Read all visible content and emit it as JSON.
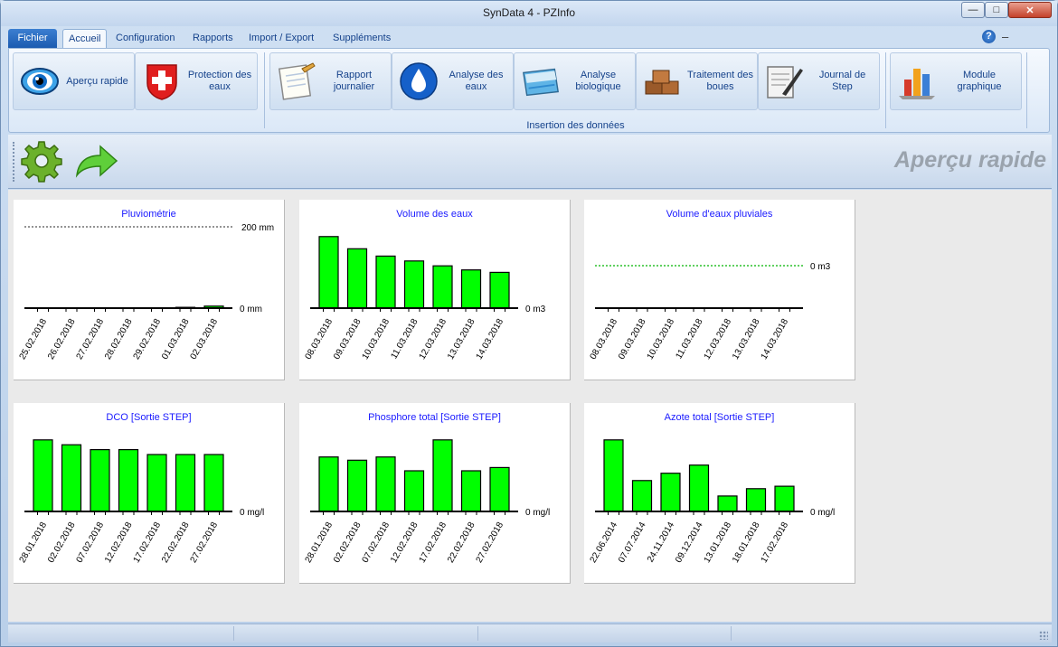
{
  "window": {
    "title": "SynData 4 - PZInfo"
  },
  "tabs": [
    {
      "label": "Fichier"
    },
    {
      "label": "Accueil"
    },
    {
      "label": "Configuration"
    },
    {
      "label": "Rapports"
    },
    {
      "label": "Import / Export"
    },
    {
      "label": "Suppléments"
    }
  ],
  "ribbon": {
    "buttons": [
      {
        "label": "Aperçu rapide",
        "icon": "eye-icon"
      },
      {
        "label": "Protection des eaux",
        "icon": "swiss-cross-icon"
      },
      {
        "label": "Rapport journalier",
        "icon": "notepad-icon"
      },
      {
        "label": "Analyse des eaux",
        "icon": "water-drop-icon"
      },
      {
        "label": "Analyse biologique",
        "icon": "basin-icon"
      },
      {
        "label": "Traitement des boues",
        "icon": "sludge-blocks-icon"
      },
      {
        "label": "Journal de Step",
        "icon": "journal-pen-icon"
      },
      {
        "label": "Module graphique",
        "icon": "bar-chart-icon"
      }
    ],
    "group_label": "Insertion des données"
  },
  "toolbar": {
    "page_title": "Aperçu rapide"
  },
  "chart_data": [
    {
      "type": "bar",
      "title": "Pluviométrie",
      "categories": [
        "25.02.2018",
        "26.02.2018",
        "27.02.2018",
        "28.02.2018",
        "29.02.2018",
        "01.03.2018",
        "02.03.2018"
      ],
      "values": [
        0,
        0,
        0,
        0,
        0,
        2,
        5
      ],
      "reference_lines": [
        {
          "value": 200,
          "label": "200 mm"
        }
      ],
      "axis_label": "0 mm",
      "ylim": [
        0,
        200
      ]
    },
    {
      "type": "bar",
      "title": "Volume des eaux",
      "categories": [
        "08.03.2018",
        "09.03.2018",
        "10.03.2018",
        "11.03.2018",
        "12.03.2018",
        "13.03.2018",
        "14.03.2018"
      ],
      "values": [
        88,
        73,
        64,
        58,
        52,
        47,
        44
      ],
      "axis_label": "0 m3",
      "ylim": [
        0,
        100
      ]
    },
    {
      "type": "bar",
      "title": "Volume d'eaux pluviales",
      "categories": [
        "08.03.2018",
        "09.03.2018",
        "10.03.2018",
        "11.03.2018",
        "12.03.2018",
        "13.03.2018",
        "14.03.2018"
      ],
      "values": [
        0,
        0,
        0,
        0,
        0,
        0,
        0
      ],
      "reference_lines": [
        {
          "value": 0,
          "label": "0 m3"
        }
      ],
      "ylim": [
        0,
        1
      ]
    },
    {
      "type": "bar",
      "title": "DCO [Sortie STEP]",
      "categories": [
        "28.01.2018",
        "02.02.2018",
        "07.02.2018",
        "12.02.2018",
        "17.02.2018",
        "22.02.2018",
        "27.02.2018"
      ],
      "values": [
        88,
        82,
        76,
        76,
        70,
        70,
        70
      ],
      "axis_label": "0 mg/l",
      "ylim": [
        0,
        100
      ]
    },
    {
      "type": "bar",
      "title": "Phosphore total [Sortie STEP]",
      "categories": [
        "28.01.2018",
        "02.02.2018",
        "07.02.2018",
        "12.02.2018",
        "17.02.2018",
        "22.02.2018",
        "27.02.2018"
      ],
      "values": [
        67,
        63,
        67,
        50,
        88,
        50,
        54
      ],
      "axis_label": "0 mg/l",
      "ylim": [
        0,
        100
      ]
    },
    {
      "type": "bar",
      "title": "Azote total [Sortie STEP]",
      "categories": [
        "22.06.2014",
        "07.07.2014",
        "24.11.2014",
        "09.12.2014",
        "13.01.2018",
        "18.01.2018",
        "17.02.2018"
      ],
      "values": [
        88,
        38,
        47,
        57,
        19,
        28,
        31
      ],
      "axis_label": "0 mg/l",
      "ylim": [
        0,
        100
      ]
    }
  ],
  "colors": {
    "bar_fill": "#00ff00",
    "bar_stroke": "#000000",
    "title_text": "#1a1aff",
    "reference_line": "#555555"
  }
}
